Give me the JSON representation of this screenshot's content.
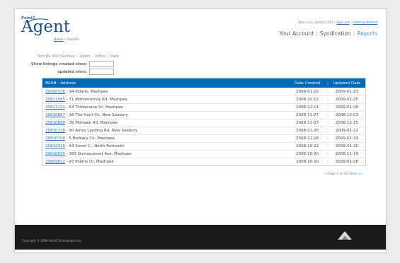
{
  "header": {
    "logo_small": "Point2",
    "logo_big": "Agent",
    "breadcrumb": {
      "home": "Home",
      "separator": "»",
      "current": "Reports"
    },
    "welcome": {
      "text": "Welcome, betty12345",
      "sep1": "|",
      "sign_out": "Sign out",
      "sep2": "|",
      "getting_started": "Getting Started"
    },
    "nav": {
      "your_account": "Your Account",
      "syndication": "Syndication",
      "reports": "Reports",
      "separator": "|"
    }
  },
  "filters": {
    "sort_by_label": "Sort By:",
    "sort_options": [
      "MLS Number",
      "Agent",
      "Office",
      "Date"
    ],
    "separator": "|",
    "created_since_label": "Show listings created since:",
    "created_since_value": "",
    "updated_since_label": "updated since:",
    "updated_since_value": ""
  },
  "table": {
    "columns": {
      "mls": "MLS# - Address",
      "created": "Date Created",
      "updated": "Updated Date",
      "separator": "|"
    },
    "rows": [
      {
        "mls": "20900576",
        "address": "94 Polaris, Mashpee",
        "created": "2009-01-22",
        "updated": "2009-01-23"
      },
      {
        "mls": "20811095",
        "address": "71 Monomoscoy Rd, Mashpee",
        "created": "2008-12-12",
        "updated": "2009-01-25"
      },
      {
        "mls": "20811121",
        "address": "63 Timberlane Dr, Mashpee",
        "created": "2008-12-11",
        "updated": "2009-01-28"
      },
      {
        "mls": "20810867",
        "address": "16 The Hunt Cir, New Seabury",
        "created": "2008-11-27",
        "updated": "2008-12-03"
      },
      {
        "mls": "20810868",
        "address": "36 Mohawk Rd, Mashpee",
        "created": "2008-11-27",
        "updated": "2008-12-25"
      },
      {
        "mls": "20810728",
        "address": "90 Amos Landing Rd, New Seabury",
        "created": "2008-11-20",
        "updated": "2009-01-12"
      },
      {
        "mls": "20810700",
        "address": "5 Barbary Cir, Mashpee",
        "created": "2008-11-18",
        "updated": "2009-01-23"
      },
      {
        "mls": "20810329",
        "address": "43 Sorrel C., North Falmouth",
        "created": "2008-10-22",
        "updated": "2009-01-20"
      },
      {
        "mls": "20810055",
        "address": "363 Quinaquisset Ave, Mashpee",
        "created": "2008-10-20",
        "updated": "2008-11-19"
      },
      {
        "mls": "20809812",
        "address": "97 Polaris Dr, Mashpee",
        "created": "2008-10-10",
        "updated": "2009-01-28"
      }
    ],
    "address_separator": " - "
  },
  "pager": {
    "prev": "<Page",
    "info": "1 of 3>",
    "next": "Next >>"
  },
  "footer": {
    "copyright": "Copyright © 2008 Point2 Technologies Inc."
  },
  "colors": {
    "header_blue": "#0068b4",
    "link_blue": "#2f6fb3",
    "footer_bg": "#1a1a1a"
  }
}
